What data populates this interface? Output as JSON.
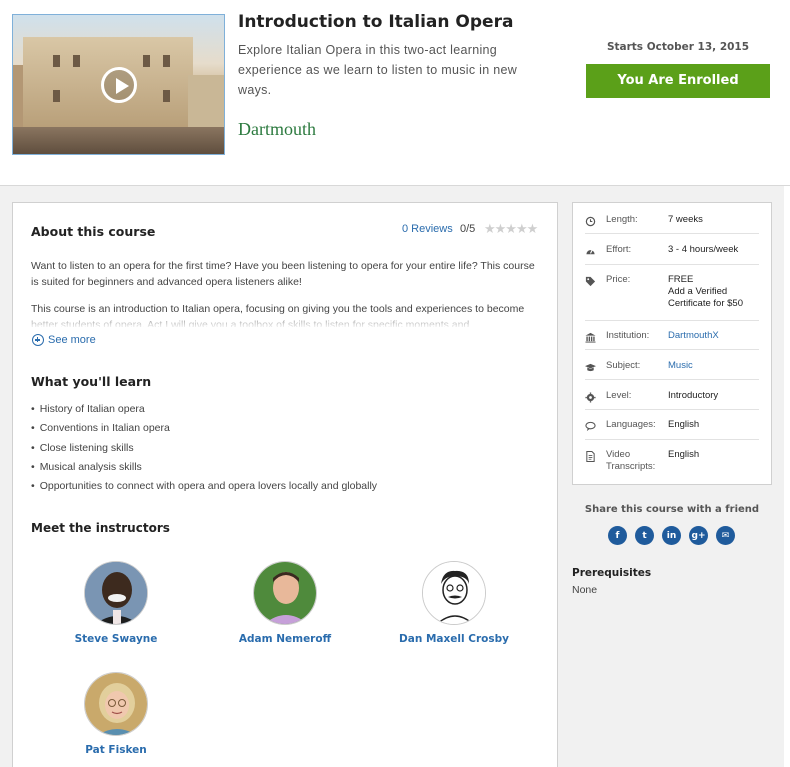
{
  "course": {
    "title": "Introduction to Italian Opera",
    "description": "Explore Italian Opera in this two-act learning experience as we learn to listen to music in new ways.",
    "school": "Dartmouth",
    "starts": "Starts October 13, 2015",
    "enroll_status": "You Are Enrolled"
  },
  "about": {
    "heading": "About this course",
    "reviews_link": "0 Reviews",
    "rating": "0/5",
    "paragraph1": "Want to listen to an opera for the first time?  Have you been listening to opera for your entire life? This course is suited for beginners and advanced opera listeners alike!",
    "paragraph2": "This course is an introduction to Italian opera, focusing on giving you the tools and experiences to become better students of opera. Act I will give you a toolbox of skills to listen for specific moments and",
    "see_more": "See more"
  },
  "learn": {
    "heading": "What you'll learn",
    "items": [
      "History of Italian opera",
      "Conventions in Italian opera",
      "Close listening skills",
      "Musical analysis skills",
      "Opportunities to connect with opera and opera lovers locally and globally"
    ]
  },
  "instructors": {
    "heading": "Meet the instructors",
    "people": [
      {
        "name": "Steve Swayne"
      },
      {
        "name": "Adam Nemeroff"
      },
      {
        "name": "Dan Maxell Crosby"
      },
      {
        "name": "Pat Fisken"
      }
    ]
  },
  "sidebar": {
    "length": {
      "label": "Length:",
      "value": "7 weeks",
      "icon": "clock-icon"
    },
    "effort": {
      "label": "Effort:",
      "value": "3 - 4 hours/week",
      "icon": "gauge-icon"
    },
    "price": {
      "label": "Price:",
      "value_line1": "FREE",
      "value_line2": "Add a Verified",
      "value_line3": "Certificate for $50",
      "icon": "tag-icon"
    },
    "institution": {
      "label": "Institution:",
      "value": "DartmouthX",
      "icon": "institution-icon"
    },
    "subject": {
      "label": "Subject:",
      "value": "Music",
      "icon": "graduation-cap-icon"
    },
    "level": {
      "label": "Level:",
      "value": "Introductory",
      "icon": "gear-icon"
    },
    "languages": {
      "label": "Languages:",
      "value": "English",
      "icon": "speech-bubble-icon"
    },
    "transcripts": {
      "label_line1": "Video",
      "label_line2": "Transcripts:",
      "value": "English",
      "icon": "document-icon"
    }
  },
  "share": {
    "heading": "Share this course with a friend",
    "buttons": [
      {
        "glyph": "f",
        "icon": "facebook-icon"
      },
      {
        "glyph": "t",
        "icon": "twitter-icon"
      },
      {
        "glyph": "in",
        "icon": "linkedin-icon"
      },
      {
        "glyph": "g+",
        "icon": "google-plus-icon"
      },
      {
        "glyph": "✉",
        "icon": "email-icon"
      }
    ]
  },
  "prerequisites": {
    "heading": "Prerequisites",
    "value": "None"
  },
  "colors": {
    "enrolled_green": "#5ba019",
    "link_blue": "#2a6cad",
    "dartmouth_green": "#2c7a3f",
    "share_blue": "#1f5b9c"
  }
}
